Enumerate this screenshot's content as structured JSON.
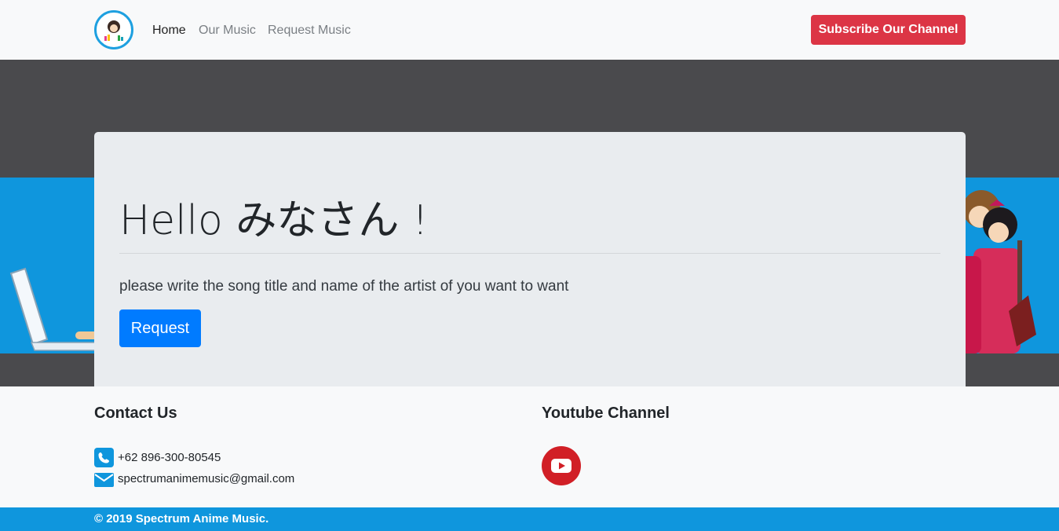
{
  "nav": {
    "links": [
      "Home",
      "Our Music",
      "Request Music"
    ],
    "subscribe_label": "Subscribe Our Channel"
  },
  "hero": {
    "title": "Hello みなさん !",
    "text": "please write the song title and name of the artist of you want to want",
    "button_label": "Request"
  },
  "footer": {
    "contact_heading": "Contact Us",
    "phone": "+62 896-300-80545",
    "email": "spectrumanimemusic@gmail.com",
    "youtube_heading": "Youtube Channel",
    "copyright": "© 2019 Spectrum Anime Music."
  },
  "colors": {
    "danger": "#dc3545",
    "primary": "#007bff",
    "footer_bar": "#0f96dd",
    "youtube": "#d11f26"
  },
  "icons": [
    "logo",
    "phone-icon",
    "mail-icon",
    "youtube-icon"
  ]
}
